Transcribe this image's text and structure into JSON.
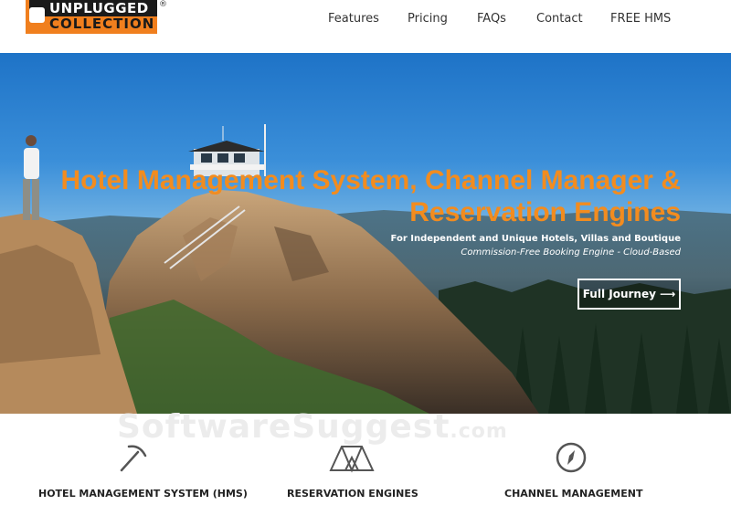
{
  "logo": {
    "line1": "UNPLUGGED",
    "line2": "COLLECTION",
    "trademark": "®"
  },
  "nav": [
    {
      "label": "Features"
    },
    {
      "label": "Pricing"
    },
    {
      "label": "FAQs"
    },
    {
      "label": "Contact"
    },
    {
      "label": "FREE HMS"
    }
  ],
  "hero": {
    "headline_line1": "Hotel Management System, Channel Manager &",
    "headline_line2": "Reservation Engines",
    "subtitle": "For Independent and Unique Hotels, Villas and Boutique",
    "tagline": "Commission-Free Booking Engine - Cloud-Based",
    "cta_label": "Full Journey ⟶"
  },
  "watermark": {
    "text": "SoftwareSuggest",
    "suffix": ".com"
  },
  "features": [
    {
      "label": "HOTEL MANAGEMENT SYSTEM (HMS)",
      "icon": "pickaxe-icon"
    },
    {
      "label": "RESERVATION ENGINES",
      "icon": "tent-icon"
    },
    {
      "label": "CHANNEL MANAGEMENT",
      "icon": "compass-icon"
    }
  ],
  "colors": {
    "accent": "#f07f1e",
    "headline": "#f28c1f",
    "sky": "#1e73c7"
  }
}
